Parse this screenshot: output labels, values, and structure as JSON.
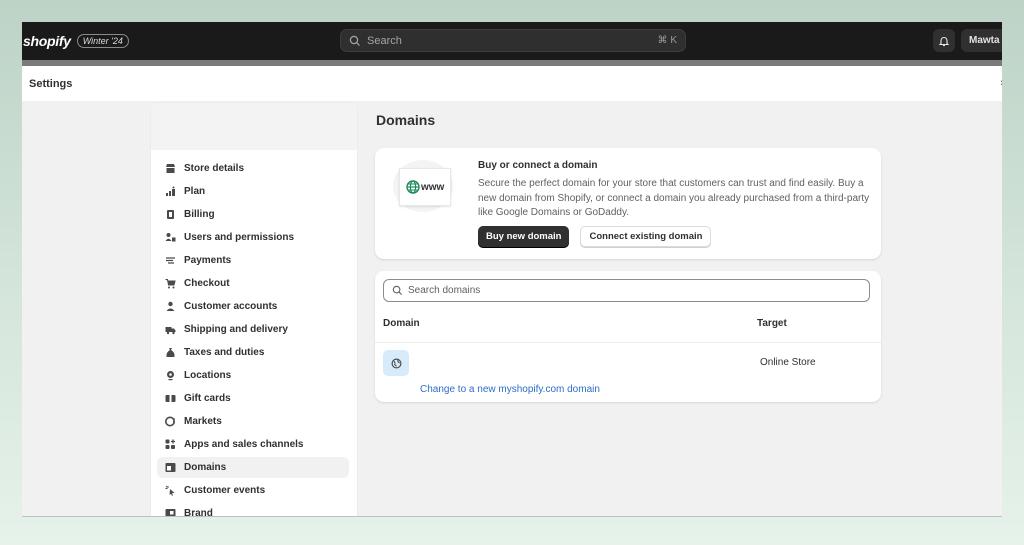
{
  "topbar": {
    "logo": "shopify",
    "edition": "Winter '24",
    "search_placeholder": "Search",
    "search_shortcut": "⌘ K",
    "bell_icon": "bell-icon",
    "user_label": "Mawta"
  },
  "settings_bar": {
    "title": "Settings",
    "close_glyph": "›"
  },
  "sidebar": {
    "items": [
      {
        "label": "Store details",
        "icon": "store-icon"
      },
      {
        "label": "Plan",
        "icon": "plan-icon"
      },
      {
        "label": "Billing",
        "icon": "billing-icon"
      },
      {
        "label": "Users and permissions",
        "icon": "users-icon"
      },
      {
        "label": "Payments",
        "icon": "payments-icon"
      },
      {
        "label": "Checkout",
        "icon": "cart-icon"
      },
      {
        "label": "Customer accounts",
        "icon": "person-icon"
      },
      {
        "label": "Shipping and delivery",
        "icon": "truck-icon"
      },
      {
        "label": "Taxes and duties",
        "icon": "money-bag-icon"
      },
      {
        "label": "Locations",
        "icon": "location-icon"
      },
      {
        "label": "Gift cards",
        "icon": "gift-card-icon"
      },
      {
        "label": "Markets",
        "icon": "globe-markets-icon"
      },
      {
        "label": "Apps and sales channels",
        "icon": "apps-icon"
      },
      {
        "label": "Domains",
        "icon": "domains-icon",
        "active": true
      },
      {
        "label": "Customer events",
        "icon": "cursor-click-icon"
      },
      {
        "label": "Brand",
        "icon": "brand-icon"
      }
    ]
  },
  "main": {
    "title": "Domains",
    "promo": {
      "illustration_text": "www",
      "title": "Buy or connect a domain",
      "description": "Secure the perfect domain for your store that customers can trust and find easily. Buy a new domain from Shopify, or connect a domain you already purchased from a third-party like Google Domains or GoDaddy.",
      "primary_button": "Buy new domain",
      "secondary_button": "Connect existing domain"
    },
    "domains": {
      "search_placeholder": "Search domains",
      "columns": [
        "Domain",
        "Target"
      ],
      "rows": [
        {
          "domain": "",
          "target": "Online Store",
          "link": "Change to a new myshopify.com domain"
        }
      ]
    }
  },
  "colors": {
    "topbar_bg": "#1a1a1a",
    "primary_button": "#303030",
    "link": "#2c6ecb",
    "globe_accent": "#1f8a5b",
    "domain_icon_bg": "#d7ebfb"
  }
}
